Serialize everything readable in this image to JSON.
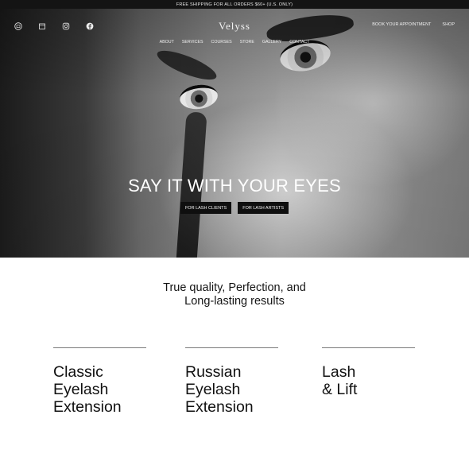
{
  "announcement": "FREE SHIPPING FOR ALL ORDERS $60+ (U.S. ONLY)",
  "brand": {
    "logo_text": "Velyss"
  },
  "social": [
    "store-icon",
    "shop-bag-icon",
    "instagram-icon",
    "facebook-icon"
  ],
  "header_links": [
    "BOOK YOUR APPOINTMENT",
    "SHOP"
  ],
  "nav": [
    "ABOUT",
    "SERVICES",
    "COURSES",
    "STORE",
    "GALLERY",
    "CONTACT"
  ],
  "hero": {
    "title": "SAY IT WITH YOUR EYES",
    "buttons": [
      "FOR LASH CLIENTS",
      "FOR LASH ARTISTS"
    ]
  },
  "tagline": [
    "True quality, Perfection, and",
    "Long-lasting results"
  ],
  "services": [
    {
      "lines": [
        "Classic",
        "Eyelash",
        "Extension"
      ]
    },
    {
      "lines": [
        "Russian",
        "Eyelash",
        "Extension"
      ]
    },
    {
      "lines": [
        "Lash",
        "& Lift"
      ]
    }
  ]
}
